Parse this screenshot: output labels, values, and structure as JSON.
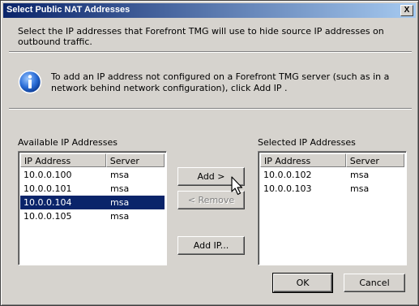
{
  "window": {
    "title": "Select Public NAT Addresses",
    "close_glyph": "X"
  },
  "intro_text": "Select the IP addresses that Forefront TMG will use to hide source IP addresses on outbound traffic.",
  "info_text": "To add an IP address not configured on a Forefront TMG server (such as in a network behind network configuration), click Add IP .",
  "available": {
    "label": "Available IP Addresses",
    "columns": [
      "IP Address",
      "Server"
    ],
    "rows": [
      {
        "ip": "10.0.0.100",
        "server": "msa",
        "selected": false
      },
      {
        "ip": "10.0.0.101",
        "server": "msa",
        "selected": false
      },
      {
        "ip": "10.0.0.104",
        "server": "msa",
        "selected": true
      },
      {
        "ip": "10.0.0.105",
        "server": "msa",
        "selected": false
      }
    ]
  },
  "selected": {
    "label": "Selected IP Addresses",
    "columns": [
      "IP Address",
      "Server"
    ],
    "rows": [
      {
        "ip": "10.0.0.102",
        "server": "msa"
      },
      {
        "ip": "10.0.0.103",
        "server": "msa"
      }
    ]
  },
  "buttons": {
    "add": "Add >",
    "remove": "< Remove",
    "add_ip": "Add IP...",
    "ok": "OK",
    "cancel": "Cancel"
  }
}
